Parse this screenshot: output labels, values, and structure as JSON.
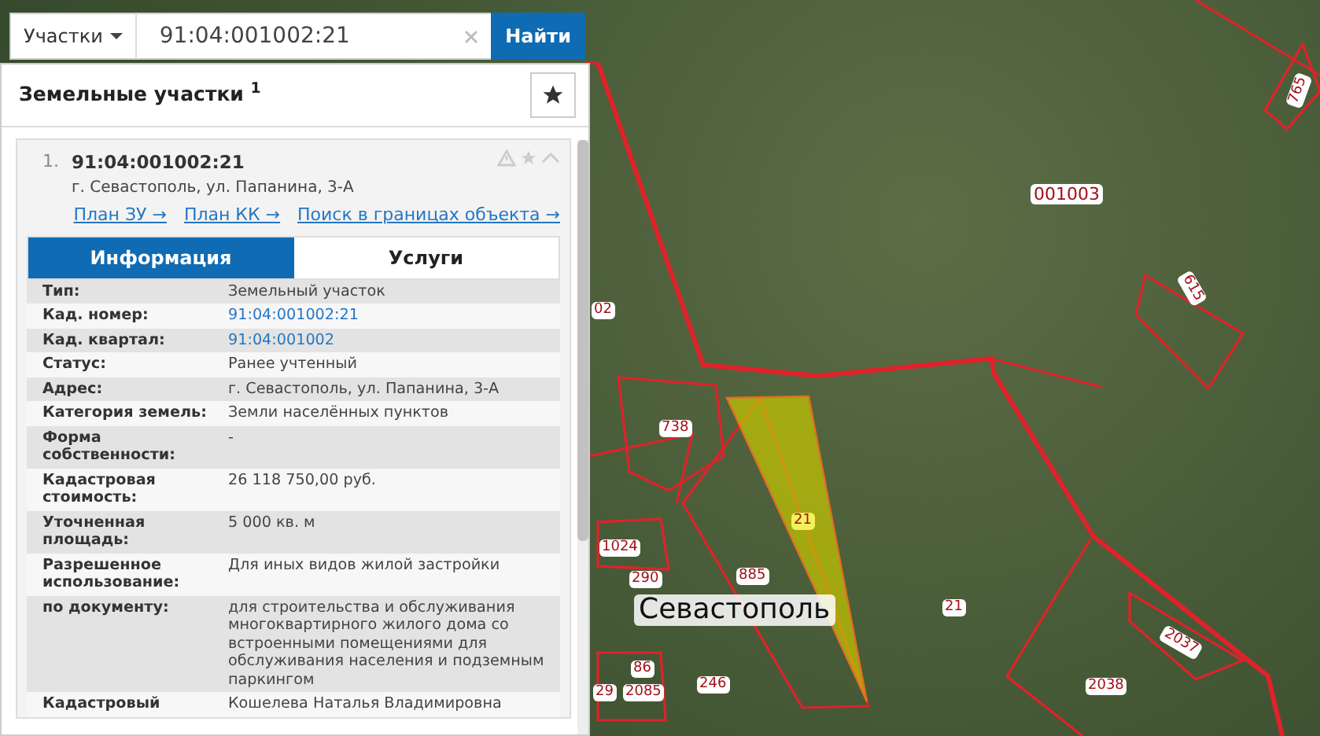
{
  "search": {
    "category": "Участки",
    "value": "91:04:001002:21",
    "button": "Найти"
  },
  "results": {
    "title": "Земельные участки $^{1}$"
  },
  "result": {
    "index": "1.",
    "number": "91:04:001002:21",
    "address": "г. Севастополь, ул. Папанина, 3-А",
    "expanded": true,
    "links": [
      "План ЗУ →",
      "План КК →",
      "Поиск в границах объекта →"
    ],
    "tabs": [
      {
        "label": "Информация",
        "selected": true
      },
      {
        "label": "Услуги",
        "selected": false
      }
    ],
    "rows": [
      {
        "label": "Тип:",
        "value": "Земельный участок",
        "kind": "text"
      },
      {
        "label": "Кад. номер:",
        "value": "91:04:001002:21",
        "kind": "link"
      },
      {
        "label": "Кад. квартал:",
        "value": "91:04:001002",
        "kind": "link"
      },
      {
        "label": "Статус:",
        "value": "Ранее учтенный",
        "kind": "text"
      },
      {
        "label": "Адрес:",
        "value": "г. Севастополь, ул. Папанина, 3-А",
        "kind": "text"
      },
      {
        "label": "Категория земель:",
        "value": "Земли населённых пунктов",
        "kind": "text"
      },
      {
        "label": "Форма собственности:",
        "value": "-",
        "kind": "text"
      },
      {
        "label": "Кадастровая стоимость:",
        "value": "26 118 750,00 руб.",
        "kind": "text"
      },
      {
        "label": "Уточненная площадь:",
        "value": "5 000 кв. м",
        "kind": "text"
      },
      {
        "label": "Разрешенное использование:",
        "value": "Для иных видов жилой застройки",
        "kind": "text"
      },
      {
        "label": "по документу:",
        "value": "для строительства и обслуживания многоквартирного жилого дома со встроенными помещениями для обслуживания населения и подземным паркингом",
        "kind": "text"
      },
      {
        "label": "Кадастровый",
        "value": "Кошелева Наталья Владимировна",
        "kind": "text"
      }
    ]
  },
  "map": {
    "city_label": "Севастополь",
    "labels": [
      {
        "text": "001003",
        "kind": "quarter"
      },
      {
        "text": "615",
        "kind": "parcel"
      },
      {
        "text": "765",
        "kind": "parcel"
      },
      {
        "text": "02",
        "kind": "parcel"
      },
      {
        "text": "738",
        "kind": "parcel"
      },
      {
        "text": "21",
        "kind": "selected"
      },
      {
        "text": "1024",
        "kind": "parcel"
      },
      {
        "text": "290",
        "kind": "parcel"
      },
      {
        "text": "885",
        "kind": "parcel"
      },
      {
        "text": "21",
        "kind": "parcel"
      },
      {
        "text": "86",
        "kind": "parcel"
      },
      {
        "text": "29",
        "kind": "parcel"
      },
      {
        "text": "2085",
        "kind": "parcel"
      },
      {
        "text": "246",
        "kind": "parcel"
      },
      {
        "text": "2037",
        "kind": "parcel"
      },
      {
        "text": "2038",
        "kind": "parcel"
      }
    ]
  }
}
